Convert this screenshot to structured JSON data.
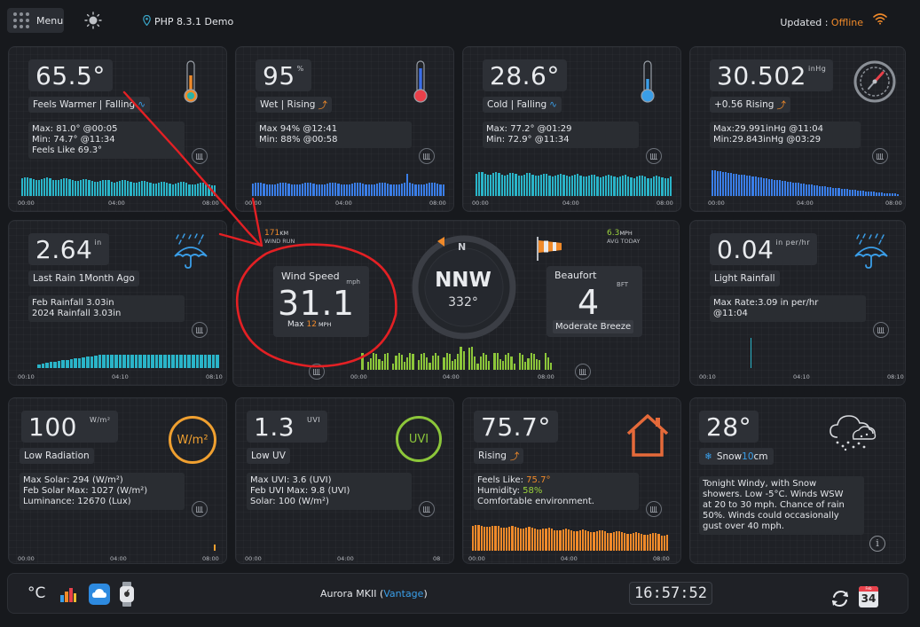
{
  "topbar": {
    "menu_label": "Menu",
    "site_title": "PHP 8.3.1 Demo",
    "updated_label": "Updated : ",
    "updated_status": "Offline"
  },
  "temperature": {
    "value": "65.5°",
    "status": "Feels Warmer | Falling",
    "info": [
      "Max: 81.0° @00:05",
      "Min: 74.7° @11:34",
      "Feels Like 69.3°"
    ],
    "ticks": [
      "00:00",
      "04:00",
      "08:00"
    ]
  },
  "humidity": {
    "value": "95",
    "unit": "%",
    "status": "Wet | Rising",
    "info": [
      "Max 94% @12:41",
      "Min: 88% @00:58"
    ],
    "ticks": [
      "00:00",
      "04:00",
      "08:00"
    ]
  },
  "dewpoint": {
    "value": "28.6°",
    "status": "Cold | Falling",
    "info": [
      "Max: 77.2° @01:29",
      "Min: 72.9° @11:34"
    ],
    "ticks": [
      "00:00",
      "04:00",
      "08:00"
    ]
  },
  "pressure": {
    "value": "30.502",
    "unit": "inHg",
    "status": "+0.56 Rising",
    "info": [
      "Max:29.991inHg @11:04",
      "Min:29.843inHg @03:29"
    ],
    "ticks": [
      "00:00",
      "04:00",
      "08:00"
    ]
  },
  "rain": {
    "value": "2.64",
    "unit": "in",
    "status": "Last Rain 1Month Ago",
    "info": [
      "Feb Rainfall 3.03in",
      "2024 Rainfall 3.03in"
    ],
    "ticks": [
      "00:10",
      "04:10",
      "08:10"
    ]
  },
  "wind": {
    "gust_value": "171",
    "gust_unit": "KM",
    "gust_label": "WIND RUN",
    "avg_value": "6.3",
    "avg_unit": "MPH",
    "avg_label": "AVG TODAY",
    "speed_label": "Wind Speed",
    "speed_unit": "mph",
    "speed_value": "31.1",
    "max_label": "Max",
    "max_value": "12",
    "max_unit": "MPH",
    "compass_north": "N",
    "direction": "NNW",
    "degrees": "332°",
    "beaufort_label": "Beaufort",
    "beaufort_unit": "BFT",
    "beaufort_value": "4",
    "beaufort_desc": "Moderate Breeze",
    "ticks": [
      "00:00",
      "04:00",
      "08:00"
    ]
  },
  "rainrate": {
    "value": "0.04",
    "unit": "in per/hr",
    "status": "Light Rainfall",
    "info": [
      "Max Rate:3.09 in per/hr",
      "@11:04"
    ],
    "ticks": [
      "00:10",
      "04:10",
      "08:10"
    ]
  },
  "solar": {
    "value": "100",
    "unit": "W/m²",
    "icon_text": "W/m²",
    "status": "Low Radiation",
    "info": [
      "Max Solar: 294 (W/m²)",
      "Feb Solar Max: 1027 (W/m²)",
      "Luminance: 12670 (Lux)"
    ],
    "ticks": [
      "00:00",
      "04:00",
      "08:00"
    ]
  },
  "uv": {
    "value": "1.3",
    "unit": "UVI",
    "icon_text": "UVI",
    "status": "Low UV",
    "info": [
      "Max UVI: 3.6 (UVI)",
      "Feb UVI Max: 9.8 (UVI)",
      "Solar: 100 (W/m²)"
    ],
    "ticks": [
      "00:00",
      "04:00",
      "08"
    ]
  },
  "indoor": {
    "value": "75.7°",
    "status": "Rising",
    "feels_label": "Feels Like: ",
    "feels_value": "75.7°",
    "humidity_label": "Humidity: ",
    "humidity_value": "58%",
    "comfort": "Comfortable environment.",
    "ticks": [
      "00:00",
      "04:00",
      "08:00"
    ]
  },
  "forecast": {
    "value": "28°",
    "snow_label": "Snow ",
    "snow_value": "10",
    "snow_unit": " cm",
    "text": [
      "Tonight Windy, with Snow",
      "showers. Low -5°C. Winds WSW",
      "at 20 to 30 mph. Chance of rain",
      "50%. Winds could occasionally",
      "gust over 40 mph."
    ]
  },
  "bottombar": {
    "unit_toggle": "°C",
    "station_name": "Aurora MKII (",
    "station_model": "Vantage",
    "station_close": ")",
    "clock": "16:57:52",
    "calendar_month": "Feb",
    "calendar_day": "34"
  },
  "colors": {
    "accent_orange": "#f08a2a",
    "accent_blue": "#3a9ee8",
    "accent_green": "#9bd23c",
    "annotation_red": "#e32024"
  }
}
